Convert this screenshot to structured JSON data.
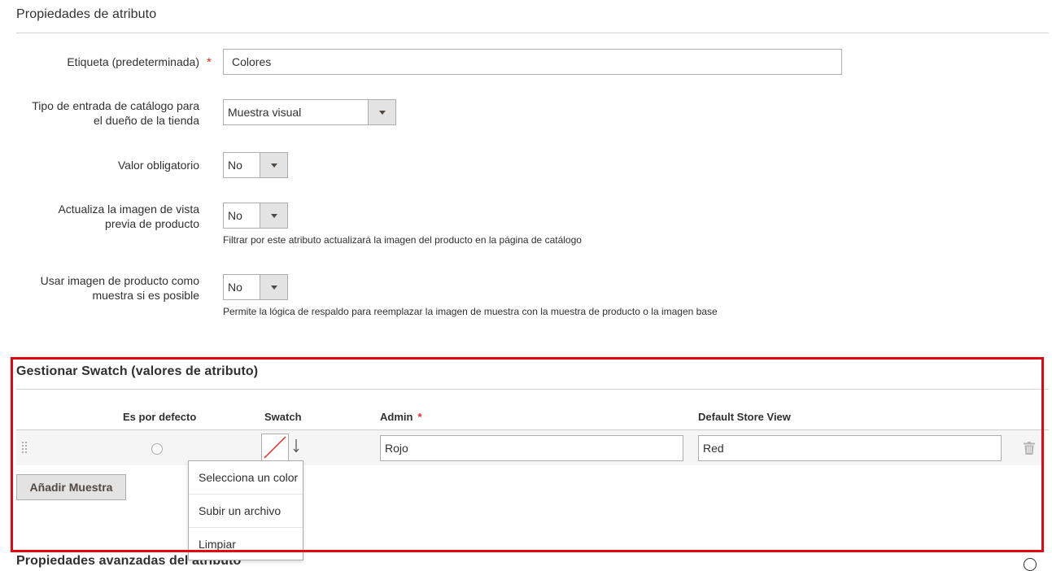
{
  "section_properties": {
    "title": "Propiedades de atributo"
  },
  "fields": {
    "label": {
      "label": "Etiqueta (predeterminada)",
      "required_mark": "*",
      "value": "Colores"
    },
    "input_type": {
      "label_line1": "Tipo de entrada de catálogo para",
      "label_line2": "el dueño de la tienda",
      "value": "Muestra visual"
    },
    "required_value": {
      "label": "Valor obligatorio",
      "value": "No"
    },
    "update_preview": {
      "label_line1": "Actualiza la imagen de vista",
      "label_line2": "previa de producto",
      "value": "No",
      "note": "Filtrar por este atributo actualizará la imagen del producto en la página de catálogo"
    },
    "use_product_image": {
      "label_line1": "Usar imagen de producto como",
      "label_line2": "muestra si es posible",
      "value": "No",
      "note": "Permite la lógica de respaldo para reemplazar la imagen de muestra con la muestra de producto o la imagen base"
    }
  },
  "swatch_section": {
    "title": "Gestionar Swatch (valores de atributo)",
    "columns": {
      "default": "Es por defecto",
      "swatch": "Swatch",
      "admin": "Admin",
      "admin_required": "*",
      "store_view": "Default Store View"
    },
    "rows": [
      {
        "admin": "Rojo",
        "store_view": "Red"
      }
    ],
    "add_button": "Añadir Muestra",
    "menu": [
      "Selecciona un color",
      "Subir un archivo",
      "Limpiar"
    ]
  },
  "section_advanced": {
    "title": "Propiedades avanzadas del atributo"
  },
  "colors": {
    "highlight": "#e30613",
    "required": "#e22626"
  }
}
